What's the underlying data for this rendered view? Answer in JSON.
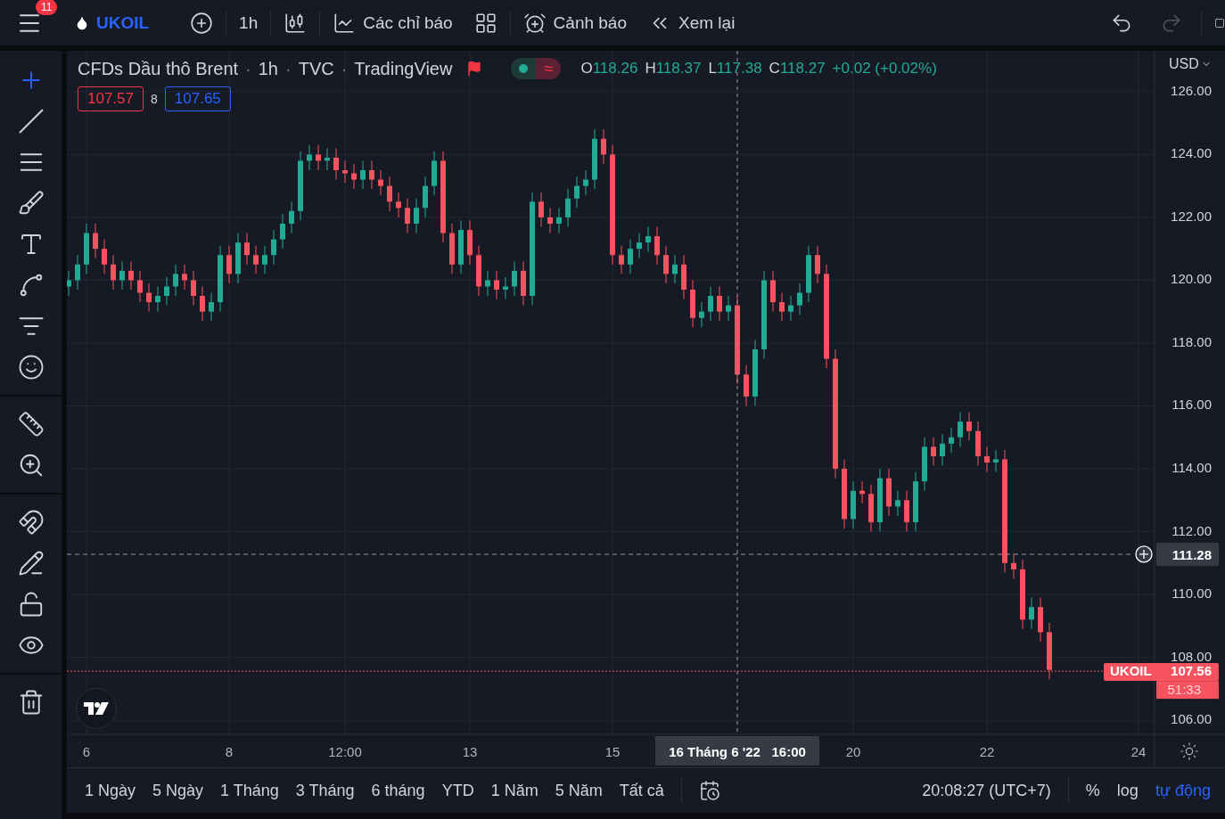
{
  "top_bar": {
    "notification_count": "11",
    "symbol": "UKOIL",
    "interval": "1h",
    "indicators_label": "Các chỉ báo",
    "alerts_label": "Cảnh báo",
    "replay_label": "Xem lại"
  },
  "legend": {
    "title": "CFDs Dầu thô Brent",
    "separator": "·",
    "interval": "1h",
    "exchange": "TVC",
    "source": "TradingView",
    "market_status_symbol": "≈",
    "ohlc": [
      {
        "key": "O",
        "value": "118.26"
      },
      {
        "key": "H",
        "value": "118.37"
      },
      {
        "key": "L",
        "value": "117.38"
      },
      {
        "key": "C",
        "value": "118.27"
      }
    ],
    "change": "+0.02 (+0.02%)",
    "bid": "107.57",
    "spread": "8",
    "ask": "107.65"
  },
  "currency": "USD",
  "last_price_tag": {
    "symbol": "UKOIL",
    "countdown": "51:33"
  },
  "chart_data": {
    "type": "candlestick",
    "grid": true,
    "ylim": [
      105.55,
      127.3
    ],
    "categories": [
      null,
      null,
      "6",
      null,
      null,
      null,
      null,
      null,
      null,
      null,
      null,
      null,
      null,
      null,
      null,
      null,
      null,
      null,
      "8",
      null,
      null,
      null,
      null,
      null,
      null,
      null,
      null,
      null,
      null,
      null,
      null,
      "12:00",
      null,
      null,
      null,
      null,
      null,
      null,
      null,
      null,
      null,
      null,
      null,
      null,
      null,
      "13",
      null,
      null,
      null,
      null,
      null,
      null,
      null,
      null,
      null,
      null,
      null,
      null,
      null,
      null,
      null,
      "15",
      null,
      null,
      null,
      null,
      null,
      null,
      null,
      null,
      null,
      null,
      null,
      null,
      null,
      "16 Tháng 6 '22   16:00",
      null,
      null,
      null,
      null,
      null,
      null,
      null,
      null,
      null,
      null,
      null,
      null,
      "20",
      null,
      null,
      null,
      null,
      null,
      null,
      null,
      null,
      null,
      null,
      null,
      null,
      null,
      null,
      "22",
      null,
      null,
      null,
      null,
      null,
      null,
      null,
      null,
      null,
      null,
      null,
      null,
      null,
      null,
      null,
      null,
      "24",
      null
    ],
    "ohlc": [
      [
        119.8,
        120.3,
        119.5,
        120
      ],
      [
        120,
        120.8,
        119.7,
        120.5
      ],
      [
        120.5,
        121.8,
        120.2,
        121.5
      ],
      [
        121.5,
        121.8,
        120.7,
        121
      ],
      [
        121,
        121.3,
        120.2,
        120.5
      ],
      [
        120.5,
        120.8,
        119.7,
        120
      ],
      [
        120,
        120.6,
        119.7,
        120.3
      ],
      [
        120.3,
        120.6,
        119.7,
        120
      ],
      [
        120,
        120.3,
        119.3,
        119.6
      ],
      [
        119.6,
        119.9,
        119,
        119.3
      ],
      [
        119.3,
        119.8,
        119,
        119.5
      ],
      [
        119.5,
        120.1,
        119.2,
        119.8
      ],
      [
        119.8,
        120.5,
        119.5,
        120.2
      ],
      [
        120.2,
        120.5,
        119.7,
        120
      ],
      [
        120,
        120.3,
        119.2,
        119.5
      ],
      [
        119.5,
        119.8,
        118.7,
        119
      ],
      [
        119,
        119.6,
        118.7,
        119.3
      ],
      [
        119.3,
        121.1,
        119,
        120.8
      ],
      [
        120.8,
        121.1,
        119.9,
        120.2
      ],
      [
        120.2,
        121.5,
        119.9,
        121.2
      ],
      [
        121.2,
        121.5,
        120.5,
        120.8
      ],
      [
        120.8,
        121.1,
        120.2,
        120.5
      ],
      [
        120.5,
        121.1,
        120.2,
        120.8
      ],
      [
        120.8,
        121.6,
        120.5,
        121.3
      ],
      [
        121.3,
        122.1,
        121,
        121.8
      ],
      [
        121.8,
        122.5,
        121.5,
        122.2
      ],
      [
        122.2,
        124.1,
        121.9,
        123.8
      ],
      [
        123.8,
        124.3,
        123.5,
        124
      ],
      [
        124,
        124.3,
        123.5,
        123.8
      ],
      [
        123.8,
        124.2,
        123.5,
        123.9
      ],
      [
        123.9,
        124.2,
        123.2,
        123.5
      ],
      [
        123.5,
        123.8,
        123.1,
        123.4
      ],
      [
        123.4,
        123.7,
        122.9,
        123.2
      ],
      [
        123.2,
        123.8,
        122.9,
        123.5
      ],
      [
        123.5,
        123.8,
        122.9,
        123.2
      ],
      [
        123.2,
        123.5,
        122.7,
        123
      ],
      [
        123,
        123.3,
        122.2,
        122.5
      ],
      [
        122.5,
        122.8,
        122,
        122.3
      ],
      [
        122.3,
        122.6,
        121.5,
        121.8
      ],
      [
        121.8,
        122.6,
        121.5,
        122.3
      ],
      [
        122.3,
        123.3,
        122,
        123
      ],
      [
        123,
        124.1,
        122.7,
        123.8
      ],
      [
        123.8,
        124.1,
        121.2,
        121.5
      ],
      [
        121.5,
        121.8,
        120.2,
        120.5
      ],
      [
        120.5,
        121.9,
        120.2,
        121.6
      ],
      [
        121.6,
        121.9,
        120.5,
        120.8
      ],
      [
        120.8,
        121.1,
        119.5,
        119.8
      ],
      [
        119.8,
        120.3,
        119.5,
        120
      ],
      [
        120,
        120.3,
        119.4,
        119.7
      ],
      [
        119.7,
        120.1,
        119.4,
        119.8
      ],
      [
        119.8,
        120.6,
        119.5,
        120.3
      ],
      [
        120.3,
        120.6,
        119.2,
        119.5
      ],
      [
        119.5,
        122.8,
        119.2,
        122.5
      ],
      [
        122.5,
        122.8,
        121.7,
        122
      ],
      [
        122,
        122.3,
        121.5,
        121.8
      ],
      [
        121.8,
        122.3,
        121.5,
        122
      ],
      [
        122,
        122.9,
        121.7,
        122.6
      ],
      [
        122.6,
        123.3,
        122.3,
        123
      ],
      [
        123,
        123.5,
        122.7,
        123.2
      ],
      [
        123.2,
        124.8,
        122.9,
        124.5
      ],
      [
        124.5,
        124.8,
        123.7,
        124
      ],
      [
        124,
        124.3,
        120.5,
        120.8
      ],
      [
        120.8,
        121.1,
        120.2,
        120.5
      ],
      [
        120.5,
        121.3,
        120.2,
        121
      ],
      [
        121,
        121.5,
        120.7,
        121.2
      ],
      [
        121.2,
        121.7,
        120.9,
        121.4
      ],
      [
        121.4,
        121.7,
        120.5,
        120.8
      ],
      [
        120.8,
        121.1,
        119.9,
        120.2
      ],
      [
        120.2,
        120.8,
        119.9,
        120.5
      ],
      [
        120.5,
        120.8,
        119.4,
        119.7
      ],
      [
        119.7,
        120,
        118.5,
        118.8
      ],
      [
        118.8,
        119.3,
        118.5,
        119
      ],
      [
        119,
        119.8,
        118.7,
        119.5
      ],
      [
        119.5,
        119.8,
        118.7,
        119
      ],
      [
        119,
        119.5,
        118.7,
        119.2
      ],
      [
        119.2,
        119.5,
        116.7,
        117
      ],
      [
        117,
        117.3,
        116,
        116.3
      ],
      [
        116.3,
        118.1,
        116,
        117.8
      ],
      [
        117.8,
        120.3,
        117.5,
        120
      ],
      [
        120,
        120.3,
        119,
        119.3
      ],
      [
        119.3,
        119.6,
        118.7,
        119
      ],
      [
        119,
        119.5,
        118.7,
        119.2
      ],
      [
        119.2,
        119.9,
        118.9,
        119.6
      ],
      [
        119.6,
        121.1,
        119.3,
        120.8
      ],
      [
        120.8,
        121.1,
        119.9,
        120.2
      ],
      [
        120.2,
        120.5,
        117.2,
        117.5
      ],
      [
        117.5,
        117.8,
        113.7,
        114
      ],
      [
        114,
        114.3,
        112.1,
        112.4
      ],
      [
        112.4,
        113.6,
        112.1,
        113.3
      ],
      [
        113.3,
        113.6,
        112.9,
        113.2
      ],
      [
        113.2,
        113.5,
        112,
        112.3
      ],
      [
        112.3,
        114,
        112,
        113.7
      ],
      [
        113.7,
        114,
        112.5,
        112.8
      ],
      [
        112.8,
        113.3,
        112.5,
        113
      ],
      [
        113,
        113.3,
        112,
        112.3
      ],
      [
        112.3,
        113.9,
        112,
        113.6
      ],
      [
        113.6,
        115,
        113.3,
        114.7
      ],
      [
        114.7,
        115,
        114.1,
        114.4
      ],
      [
        114.4,
        115.1,
        114.1,
        114.8
      ],
      [
        114.8,
        115.3,
        114.5,
        115
      ],
      [
        115,
        115.8,
        114.7,
        115.5
      ],
      [
        115.5,
        115.8,
        114.9,
        115.2
      ],
      [
        115.2,
        115.5,
        114.1,
        114.4
      ],
      [
        114.4,
        114.7,
        113.9,
        114.2
      ],
      [
        114.2,
        114.6,
        113.9,
        114.3
      ],
      [
        114.3,
        114.6,
        110.7,
        111
      ],
      [
        111,
        111.3,
        110.5,
        110.8
      ],
      [
        110.8,
        111.1,
        108.9,
        109.2
      ],
      [
        109.2,
        109.9,
        108.9,
        109.6
      ],
      [
        109.6,
        109.9,
        108.5,
        108.8
      ],
      [
        108.8,
        109.1,
        107.3,
        107.6
      ],
      null,
      null,
      null,
      null,
      null,
      null,
      null,
      null,
      null,
      null,
      null
    ],
    "yticks": [
      {
        "value": 106,
        "label": "106.00"
      },
      {
        "value": 108,
        "label": "108.00"
      },
      {
        "value": 110,
        "label": "110.00"
      },
      {
        "value": 112,
        "label": "112.00"
      },
      {
        "value": 114,
        "label": "114.00"
      },
      {
        "value": 116,
        "label": "116.00"
      },
      {
        "value": 118,
        "label": "118.00"
      },
      {
        "value": 120,
        "label": "120.00"
      },
      {
        "value": 122,
        "label": "122.00"
      },
      {
        "value": 124,
        "label": "124.00"
      },
      {
        "value": 126,
        "label": "126.00"
      }
    ],
    "ref_lines": [
      {
        "axis": "x",
        "value": "16 Tháng 6 '22   16:00",
        "color": "#9598a1"
      },
      {
        "axis": "y",
        "value": 111.28,
        "label": "111.28",
        "color": "#9598a1"
      },
      {
        "axis": "y",
        "value": 107.56,
        "label": "107.56",
        "color": "#f7525f"
      }
    ]
  },
  "range_buttons": [
    "1 Ngày",
    "5 Ngày",
    "1 Tháng",
    "3 Tháng",
    "6 tháng",
    "YTD",
    "1 Năm",
    "5 Năm",
    "Tất cả"
  ],
  "clock": "20:08:27 (UTC+7)",
  "scale_options": [
    {
      "label": "%",
      "selected": false
    },
    {
      "label": "log",
      "selected": false
    },
    {
      "label": "tự động",
      "selected": true
    }
  ]
}
